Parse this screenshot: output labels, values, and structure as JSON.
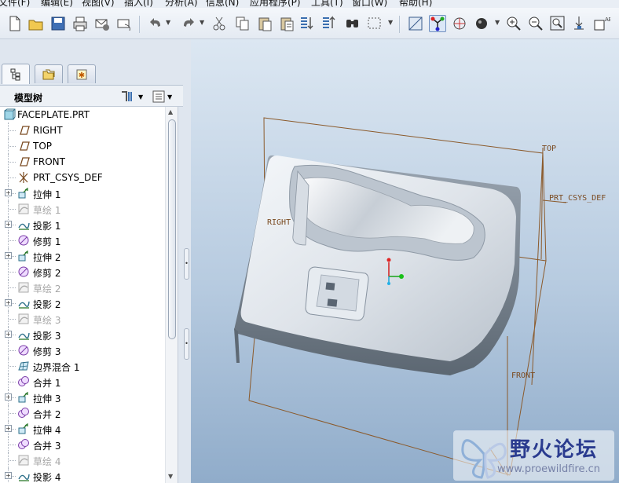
{
  "menu": [
    "文件(F)",
    "编辑(E)",
    "视图(V)",
    "插入(I)",
    "分析(A)",
    "信息(N)",
    "应用程序(P)",
    "工具(T)",
    "窗口(W)",
    "帮助(H)"
  ],
  "toolbar": {
    "icons": [
      "new-file-icon",
      "open-file-icon",
      "save-icon",
      "print-icon",
      "send-mail-icon",
      "mail-attach-icon",
      "undo-icon",
      "redo-icon",
      "cut-icon",
      "copy-icon",
      "paste-icon",
      "paste-special-icon",
      "regenerate-icon",
      "regen-manager-icon",
      "find-icon",
      "select-box-icon",
      "repaint-icon",
      "orient-mode-icon",
      "spin-center-icon",
      "shading-icon",
      "zoom-in-icon",
      "zoom-out-icon",
      "refit-icon",
      "datum-display-icon",
      "annotation-display-icon"
    ]
  },
  "left_panel": {
    "tabs": [
      "model-tree-tab",
      "folder-browser-tab",
      "favorites-tab"
    ],
    "tree_title": "模型树"
  },
  "tree": [
    {
      "label": "FACEPLATE.PRT",
      "icon": "part-icon",
      "root": true,
      "expand": false,
      "dim": false
    },
    {
      "label": "RIGHT",
      "icon": "datum-plane-icon",
      "expand": false,
      "dim": false
    },
    {
      "label": "TOP",
      "icon": "datum-plane-icon",
      "expand": false,
      "dim": false
    },
    {
      "label": "FRONT",
      "icon": "datum-plane-icon",
      "expand": false,
      "dim": false
    },
    {
      "label": "PRT_CSYS_DEF",
      "icon": "csys-icon",
      "expand": false,
      "dim": false
    },
    {
      "label": "拉伸 1",
      "icon": "extrude-icon",
      "expand": true,
      "dim": false
    },
    {
      "label": "草绘 1",
      "icon": "sketch-icon",
      "expand": false,
      "dim": true
    },
    {
      "label": "投影 1",
      "icon": "projection-icon",
      "expand": true,
      "dim": false
    },
    {
      "label": "修剪 1",
      "icon": "trim-icon",
      "expand": false,
      "dim": false
    },
    {
      "label": "拉伸 2",
      "icon": "extrude-icon",
      "expand": true,
      "dim": false
    },
    {
      "label": "修剪 2",
      "icon": "trim-icon",
      "expand": false,
      "dim": false
    },
    {
      "label": "草绘 2",
      "icon": "sketch-icon",
      "expand": false,
      "dim": true
    },
    {
      "label": "投影 2",
      "icon": "projection-icon",
      "expand": true,
      "dim": false
    },
    {
      "label": "草绘 3",
      "icon": "sketch-icon",
      "expand": false,
      "dim": true
    },
    {
      "label": "投影 3",
      "icon": "projection-icon",
      "expand": true,
      "dim": false
    },
    {
      "label": "修剪 3",
      "icon": "trim-icon",
      "expand": false,
      "dim": false
    },
    {
      "label": "边界混合 1",
      "icon": "boundary-blend-icon",
      "expand": false,
      "dim": false
    },
    {
      "label": "合并 1",
      "icon": "merge-icon",
      "expand": false,
      "dim": false
    },
    {
      "label": "拉伸 3",
      "icon": "extrude-icon",
      "expand": true,
      "dim": false
    },
    {
      "label": "合并 2",
      "icon": "merge-icon",
      "expand": false,
      "dim": false
    },
    {
      "label": "拉伸 4",
      "icon": "extrude-icon",
      "expand": true,
      "dim": false
    },
    {
      "label": "合并 3",
      "icon": "merge-icon",
      "expand": false,
      "dim": false
    },
    {
      "label": "草绘 4",
      "icon": "sketch-icon",
      "expand": false,
      "dim": true
    },
    {
      "label": "投影 4",
      "icon": "projection-icon",
      "expand": true,
      "dim": false
    }
  ],
  "viewport": {
    "datum_labels": {
      "top": "TOP",
      "right": "RIGHT",
      "front": "FRONT",
      "csys": "PRT_CSYS_DEF"
    }
  },
  "watermark": {
    "title": "野火论坛",
    "url": "www.proewildfire.cn"
  },
  "colors": {
    "datum": "#8b5a2b",
    "accent": "#3b6fb6"
  }
}
